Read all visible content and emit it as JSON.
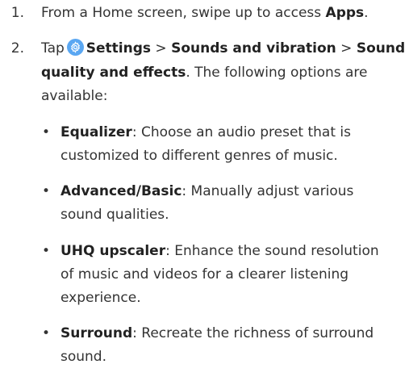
{
  "step1": {
    "number": "1.",
    "text_a": "From a Home screen, swipe up to access ",
    "apps": "Apps",
    "period": "."
  },
  "step2": {
    "number": "2.",
    "tap": "Tap",
    "settings": "Settings",
    "sep1": " > ",
    "sounds": "Sounds and vibration",
    "sep2": " > ",
    "sound": "Sound",
    "quality": "quality and effects",
    "text_b": ". The following options are",
    "available": "available:"
  },
  "options": [
    {
      "name": "Equalizer",
      "line1": ": Choose an audio preset that is",
      "line2": "customized to different genres of music."
    },
    {
      "name": "Advanced/Basic",
      "line1": ": Manually adjust various",
      "line2": "sound qualities."
    },
    {
      "name": "UHQ upscaler",
      "line1": ": Enhance the sound resolution",
      "line2": "of music and videos for a clearer listening",
      "line3": "experience."
    },
    {
      "name": "Surround",
      "line1": ": Recreate the richness of surround",
      "line2": "sound."
    }
  ],
  "bullet_char": "•",
  "icon": "settings-gear-icon",
  "colors": {
    "text": "#333333",
    "icon_bg": "#5aa7f2"
  }
}
